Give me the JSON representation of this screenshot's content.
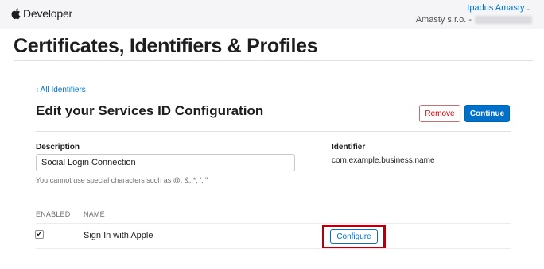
{
  "topbar": {
    "brand": "Developer",
    "user_name": "Ipadus Amasty",
    "user_chevron": "⌄",
    "team_name": "Amasty s.r.o. -"
  },
  "page": {
    "title": "Certificates, Identifiers & Profiles"
  },
  "section": {
    "back_link": "‹ All Identifiers",
    "title": "Edit your Services ID Configuration",
    "remove_label": "Remove",
    "continue_label": "Continue"
  },
  "form": {
    "description_label": "Description",
    "description_value": "Social Login Connection",
    "description_hint": "You cannot use special characters such as @, &, *, ', \"",
    "identifier_label": "Identifier",
    "identifier_value": "com.example.business.name"
  },
  "capabilities": {
    "col_enabled": "ENABLED",
    "col_name": "NAME",
    "rows": [
      {
        "name": "Sign In with Apple",
        "enabled": true,
        "action": "Configure"
      }
    ]
  },
  "icons": {
    "brand_logo": "apple-logo-icon",
    "checkbox": "checkmark-icon"
  },
  "colors": {
    "accent": "#0070c9",
    "danger": "#d00000",
    "highlight": "#b3000f"
  }
}
